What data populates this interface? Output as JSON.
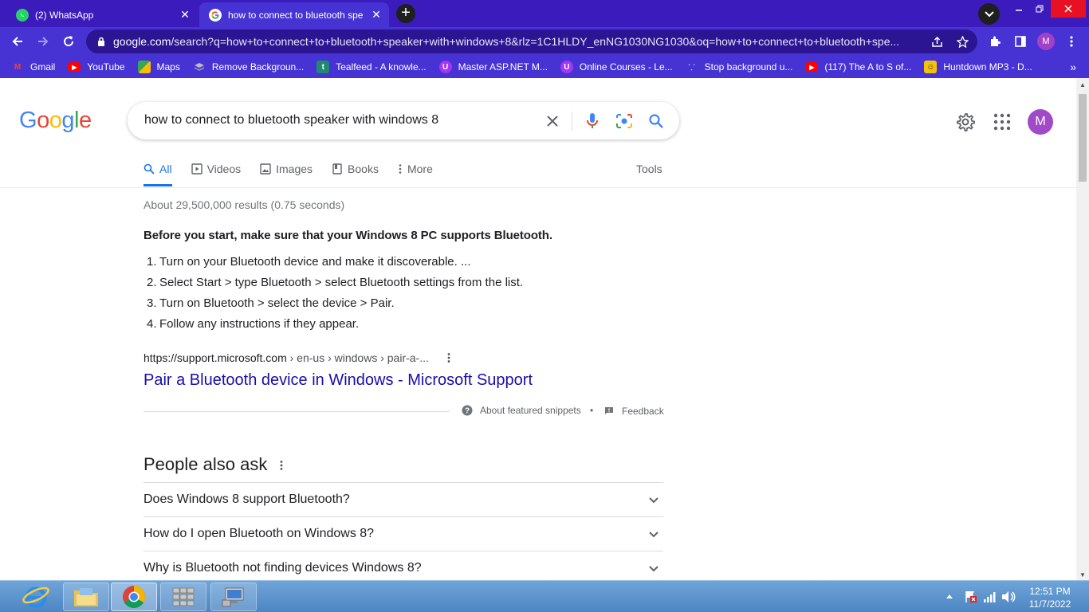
{
  "window": {
    "tabs": [
      {
        "title": "(2) WhatsApp",
        "favicon": "whatsapp-icon",
        "active": false
      },
      {
        "title": "how to connect to bluetooth spe",
        "favicon": "google-icon",
        "active": true
      }
    ]
  },
  "toolbar": {
    "url_host": "google.com",
    "url_path": "/search?q=how+to+connect+to+bluetooth+speaker+with+windows+8&rlz=1C1HLDY_enNG1030NG1030&oq=how+to+connect+to+bluetooth+spe...",
    "profile_initial": "M"
  },
  "bookmarks": [
    {
      "label": "Gmail",
      "icon": "gmail-icon",
      "color": "#ea4335"
    },
    {
      "label": "YouTube",
      "icon": "youtube-icon",
      "color": "#ff0000"
    },
    {
      "label": "Maps",
      "icon": "maps-icon",
      "color": "#34a853"
    },
    {
      "label": "Remove Backgroun...",
      "icon": "removebg-icon",
      "color": "#9e9e9e"
    },
    {
      "label": "Tealfeed - A knowle...",
      "icon": "tealfeed-icon",
      "color": "#1f8a70"
    },
    {
      "label": "Master ASP.NET M...",
      "icon": "udemy-icon",
      "color": "#a435f0"
    },
    {
      "label": "Online Courses - Le...",
      "icon": "udemy-icon",
      "color": "#a435f0"
    },
    {
      "label": "Stop background u...",
      "icon": "web-icon",
      "color": "#4a90d9"
    },
    {
      "label": "(117) The A to S of...",
      "icon": "youtube-icon",
      "color": "#ff0000"
    },
    {
      "label": "Huntdown MP3 - D...",
      "icon": "huntdown-icon",
      "color": "#f4c20d"
    }
  ],
  "google": {
    "logo": "Google",
    "query": "how to connect to bluetooth speaker with windows 8",
    "account_initial": "M",
    "tabs": [
      {
        "label": "All",
        "icon": "search-icon",
        "active": true
      },
      {
        "label": "Videos",
        "icon": "video-icon",
        "active": false
      },
      {
        "label": "Images",
        "icon": "image-icon",
        "active": false
      },
      {
        "label": "Books",
        "icon": "book-icon",
        "active": false
      },
      {
        "label": "More",
        "icon": "more-icon",
        "active": false
      }
    ],
    "tools_label": "Tools",
    "result_stats": "About 29,500,000 results (0.75 seconds)",
    "featured_snippet": {
      "heading": "Before you start, make sure that your Windows 8 PC supports Bluetooth.",
      "steps": [
        "Turn on your Bluetooth device and make it discoverable. ...",
        "Select Start > type Bluetooth > select Bluetooth settings from the list.",
        "Turn on Bluetooth > select the device > Pair.",
        "Follow any instructions if they appear."
      ],
      "source_host": "https://support.microsoft.com",
      "source_path": " › en-us › windows › pair-a-...",
      "title": "Pair a Bluetooth device in Windows - Microsoft Support",
      "about_label": "About featured snippets",
      "separator": "•",
      "feedback_label": "Feedback"
    },
    "people_also_ask": {
      "heading": "People also ask",
      "questions": [
        "Does Windows 8 support Bluetooth?",
        "How do I open Bluetooth on Windows 8?",
        "Why is Bluetooth not finding devices Windows 8?"
      ]
    }
  },
  "taskbar": {
    "apps": [
      {
        "name": "internet-explorer-icon",
        "state": "none"
      },
      {
        "name": "file-explorer-icon",
        "state": "pinned"
      },
      {
        "name": "chrome-icon",
        "state": "running"
      },
      {
        "name": "app-grid-icon",
        "state": "pinned"
      },
      {
        "name": "remote-desktop-icon",
        "state": "pinned"
      }
    ],
    "time": "12:51 PM",
    "date": "11/7/2022"
  }
}
